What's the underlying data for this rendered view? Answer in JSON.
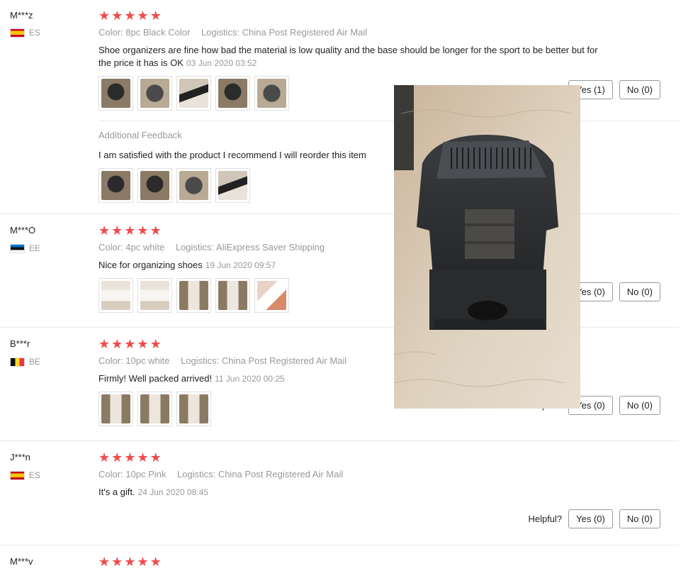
{
  "colors": {
    "star": "#f14b4b",
    "meta": "#999999",
    "border": "#e8e8e8"
  },
  "reviews": [
    {
      "user": "M***z",
      "country": "ES",
      "stars": [
        "★",
        "★",
        "★",
        "★",
        "★"
      ],
      "color": "Color: 8pc Black Color",
      "logistics": "Logistics: China Post Registered Air Mail",
      "text": "Shoe organizers are fine how bad the material is low quality and the base should be longer for the sport to be better but for the price it has is OK",
      "date": "03 Jun 2020 03:52",
      "additional_label": "Additional Feedback",
      "additional_text": "I am satisfied with the product I recommend I will reorder this item",
      "yes": "Yes (1)",
      "no": "No (0)"
    },
    {
      "user": "M***O",
      "country": "EE",
      "stars": [
        "★",
        "★",
        "★",
        "★",
        "★"
      ],
      "color": "Color: 4pc white",
      "logistics": "Logistics: AliExpress Saver Shipping",
      "text": "Nice for organizing shoes",
      "date": "19 Jun 2020 09:57",
      "yes": "Yes (0)",
      "no": "No (0)"
    },
    {
      "user": "B***r",
      "country": "BE",
      "stars": [
        "★",
        "★",
        "★",
        "★",
        "★"
      ],
      "color": "Color: 10pc white",
      "logistics": "Logistics: China Post Registered Air Mail",
      "text": "Firmly! Well packed arrived!",
      "date": "11 Jun 2020 00:25",
      "helpful": "Helpful?",
      "yes": "Yes (0)",
      "no": "No (0)"
    },
    {
      "user": "J***n",
      "country": "ES",
      "stars": [
        "★",
        "★",
        "★",
        "★",
        "★"
      ],
      "color": "Color: 10pc Pink",
      "logistics": "Logistics: China Post Registered Air Mail",
      "text": "It's a gift.",
      "date": "24 Jun 2020 08:45",
      "helpful": "Helpful?",
      "yes": "Yes (0)",
      "no": "No (0)"
    },
    {
      "user": "M***v",
      "stars": [
        "★",
        "★",
        "★",
        "★",
        "★"
      ]
    }
  ]
}
